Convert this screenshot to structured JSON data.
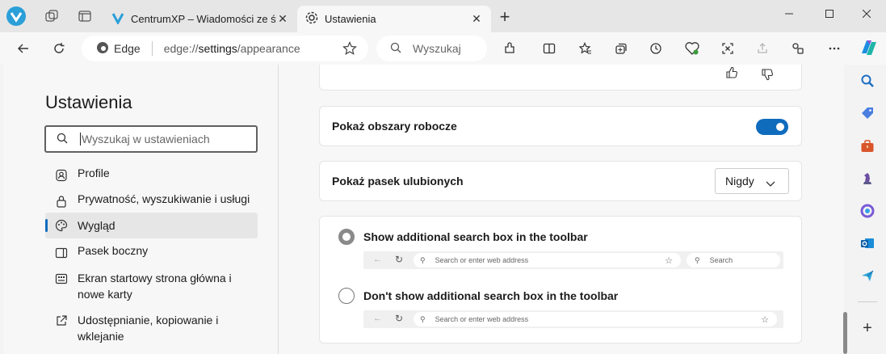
{
  "tabs": [
    {
      "title": "CentrumXP – Wiadomości ze świ"
    },
    {
      "title": "Ustawienia"
    }
  ],
  "address": {
    "site_label": "Edge",
    "url_prefix": "edge://",
    "url_main": "settings",
    "url_suffix": "/appearance"
  },
  "search_box": {
    "placeholder": "Wyszukaj"
  },
  "sidebar": {
    "title": "Ustawienia",
    "search_placeholder": "Wyszukaj w ustawieniach",
    "items": [
      {
        "label": "Profile",
        "icon": "profile-icon"
      },
      {
        "label": "Prywatność, wyszukiwanie i usługi",
        "icon": "lock-icon"
      },
      {
        "label": "Wygląd",
        "icon": "palette-icon",
        "active": true
      },
      {
        "label": "Pasek boczny",
        "icon": "sidebar-icon"
      },
      {
        "label": "Ekran startowy strona główna i nowe karty",
        "icon": "home-icon"
      },
      {
        "label": "Udostępnianie, kopiowanie i wklejanie",
        "icon": "share-icon"
      }
    ]
  },
  "main": {
    "workspaces_label": "Pokaż obszary robocze",
    "workspaces_enabled": true,
    "favorites_bar_label": "Pokaż pasek ulubionych",
    "favorites_bar_value": "Nigdy",
    "search_option_on": "Show additional search box in the toolbar",
    "search_option_off": "Don't show additional search box in the toolbar",
    "mock_address": "Search or enter web address",
    "mock_search": "Search"
  },
  "colors": {
    "accent": "#0f6cbd"
  }
}
